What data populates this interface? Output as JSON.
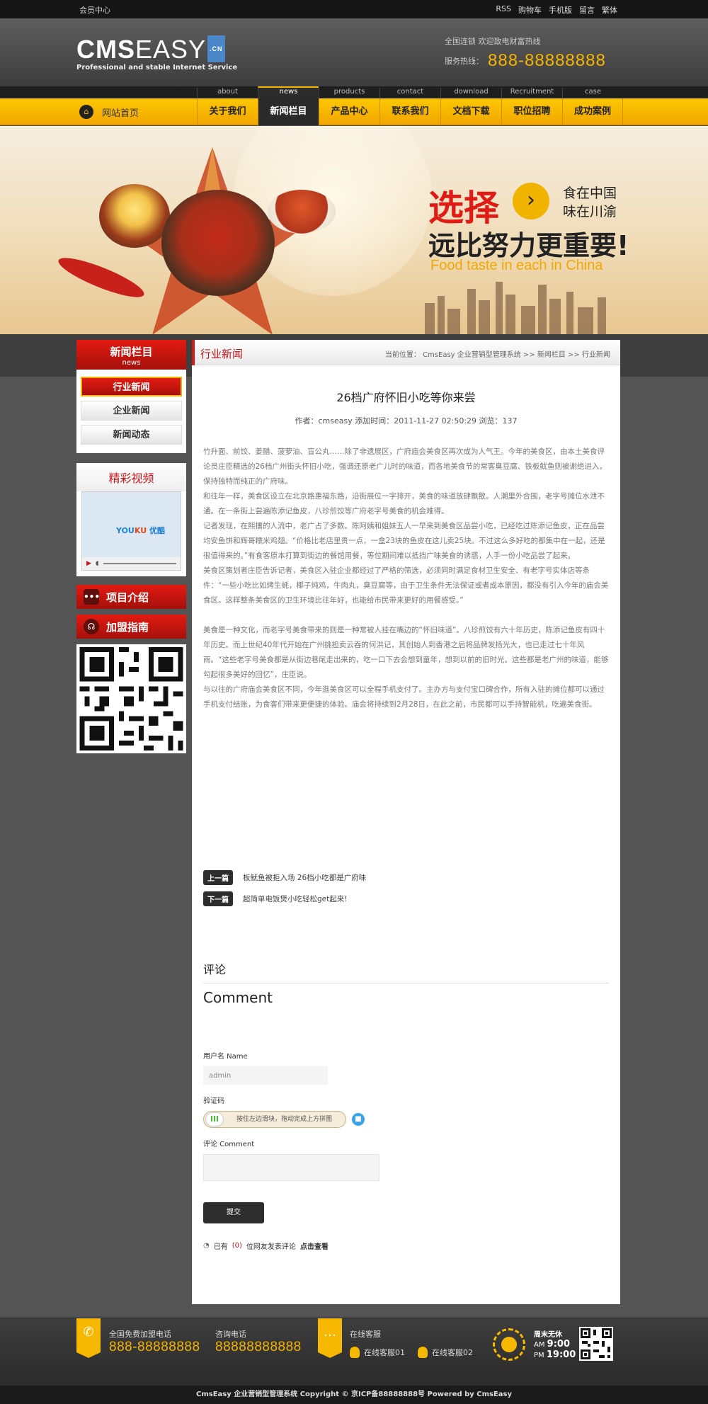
{
  "topbar": {
    "member": "会员中心",
    "links": [
      "RSS",
      "购物车",
      "手机版",
      "留言",
      "繁体"
    ]
  },
  "header": {
    "logo_main": "CMS",
    "logo_thin": "EASY",
    "logo_cn": ".CN",
    "logo_slogan": "Professional and stable Internet Service",
    "hotline_line1": "全国连锁   欢迎致电财富热线",
    "hotline_label": "服务热线：",
    "hotline_number": "888-88888888"
  },
  "nav": {
    "home": "网站首页",
    "items": [
      {
        "en": "about",
        "cn": "关于我们"
      },
      {
        "en": "news",
        "cn": "新闻栏目"
      },
      {
        "en": "products",
        "cn": "产品中心"
      },
      {
        "en": "contact",
        "cn": "联系我们"
      },
      {
        "en": "download",
        "cn": "文档下载"
      },
      {
        "en": "Recruitment",
        "cn": "职位招聘"
      },
      {
        "en": "case",
        "cn": "成功案例"
      }
    ],
    "active_index": 1
  },
  "banner": {
    "t1": "选择",
    "t2a": "食在中国",
    "t2b": "味在川渝",
    "t3": "远比努力更重要!",
    "t4": "Food taste in each in China",
    "arrow": "›"
  },
  "sidebar": {
    "title": "新闻栏目",
    "title_en": "news",
    "items": [
      "行业新闻",
      "企业新闻",
      "新闻动态"
    ],
    "active_index": 0,
    "video_title": "精彩视频",
    "video_brand_a": "YOU",
    "video_brand_b": "KU",
    "video_brand_c": "优酷",
    "intro_btn": "项目介绍",
    "join_btn": "加盟指南"
  },
  "content": {
    "category": "行业新闻",
    "breadcrumb": "当前位置： CmsEasy 企业营销型管理系统  >>  新闻栏目  >>  行业新闻",
    "title": "26档广府怀旧小吃等你来尝",
    "meta": "作者：cmseasy    添加时间：2011-11-27 02:50:29    浏览：137",
    "paragraphs": [
      "竹升面、前饺、姜醋、菠萝油、盲公丸……除了非遗展区，广府庙会美食区再次成为人气王。今年的美食区，由本土美食评论员庄臣精选的26档广州街头怀旧小吃，强调还原老广儿时的味道，而各地美食节的常客臭豆腐、铁板鱿鱼则被谢绝进入，保持独特而纯正的广府味。",
      "和往年一样，美食区设立在北京路惠福东路，沿街展位一字排开，美食的味道放肆飘散。人潮里外合围，老字号摊位水泄不通。在一条街上尝遍陈添记鱼皮，八珍煎饺等广府老字号美食的机会难得。",
      "记者发现，在熙攘的人流中，老广占了多数。陈阿姨和姐妹五人一早来到美食区品尝小吃，已经吃过陈添记鱼皮，正在品尝均安鱼饼和辉哥糯米鸡翅。“价格比老店里贵一点，一盒23块的鱼皮在这儿卖25块。不过这么多好吃的都集中在一起，还是很值得来的。”有食客原本打算到街边的餐馆用餐，等位期间难以抵挡广味美食的诱惑，人手一份小吃品尝了起来。",
      "美食区策划者庄臣告诉记者，美食区入驻企业都经过了严格的筛选，必须同时满足食材卫生安全、有老字号实体店等条件：“一些小吃比如烤生蚝，椰子炖鸡，牛肉丸，臭豆腐等，由于卫生条件无法保证或者成本原因，都没有引入今年的庙会美食区。这样整条美食区的卫生环境比往年好，也能给市民带来更好的用餐感受。”",
      "美食是一种文化，而老字号美食带来的则是一种常被人挂在嘴边的“怀旧味道”。八珍煎饺有六十年历史，陈添记鱼皮有四十年历史。而上世纪40年代开始在广州挑担卖云吞的何洪记，其创始人到香港之后将品牌发扬光大，也已走过七十年风雨。“这些老字号美食都是从街边巷尾走出来的，吃一口下去会想到童年，想到以前的旧时光。这些都是老广州的味道，能够勾起很多美好的回忆”，庄臣说。",
      "与以往的广府庙会美食区不同，今年逛美食区可以全程手机支付了。主办方与支付宝口碑合作，所有入驻的摊位都可以通过手机支付结账，为食客们带来更便捷的体验。庙会将持续到2月28日，在此之前，市民都可以手持智能机，吃遍美食街。"
    ],
    "prev_label": "上一篇",
    "prev_title": "板鱿鱼被拒入场 26档小吃都是广府味",
    "next_label": "下一篇",
    "next_title": "超简单电饭煲小吃轻松get起来!"
  },
  "comment": {
    "title_cn": "评论",
    "title_en": "Comment",
    "username_label": "用户名 Name",
    "username_value": "admin",
    "captcha_label": "验证码",
    "captcha_hint": "按住左边滑块，拖动完成上方拼图",
    "captcha_knob": "III",
    "comment_label": "评论 Comment",
    "submit": "提交",
    "count_prefix": "已有",
    "count": "(0)",
    "count_suffix": "位网友发表评论",
    "view_link": "点击查看"
  },
  "footer": {
    "phone_label": "全国免费加盟电话",
    "phone_number": "888-88888888",
    "consult_label": "咨询电话",
    "consult_number": "88888888888",
    "service_label": "在线客服",
    "service1": "在线客服01",
    "service2": "在线客服02",
    "worktime_label": "周末无休",
    "am_label": "AM",
    "am_time": "9:00",
    "pm_label": "PM",
    "pm_time": "19:00",
    "copyright": "CmsEasy 企业营销型管理系统 Copyright © 京ICP备88888888号 Powered by CmsEasy"
  },
  "colors": {
    "accent": "#f6b800",
    "brand_red": "#c8151a",
    "dark": "#2d2d2d"
  }
}
